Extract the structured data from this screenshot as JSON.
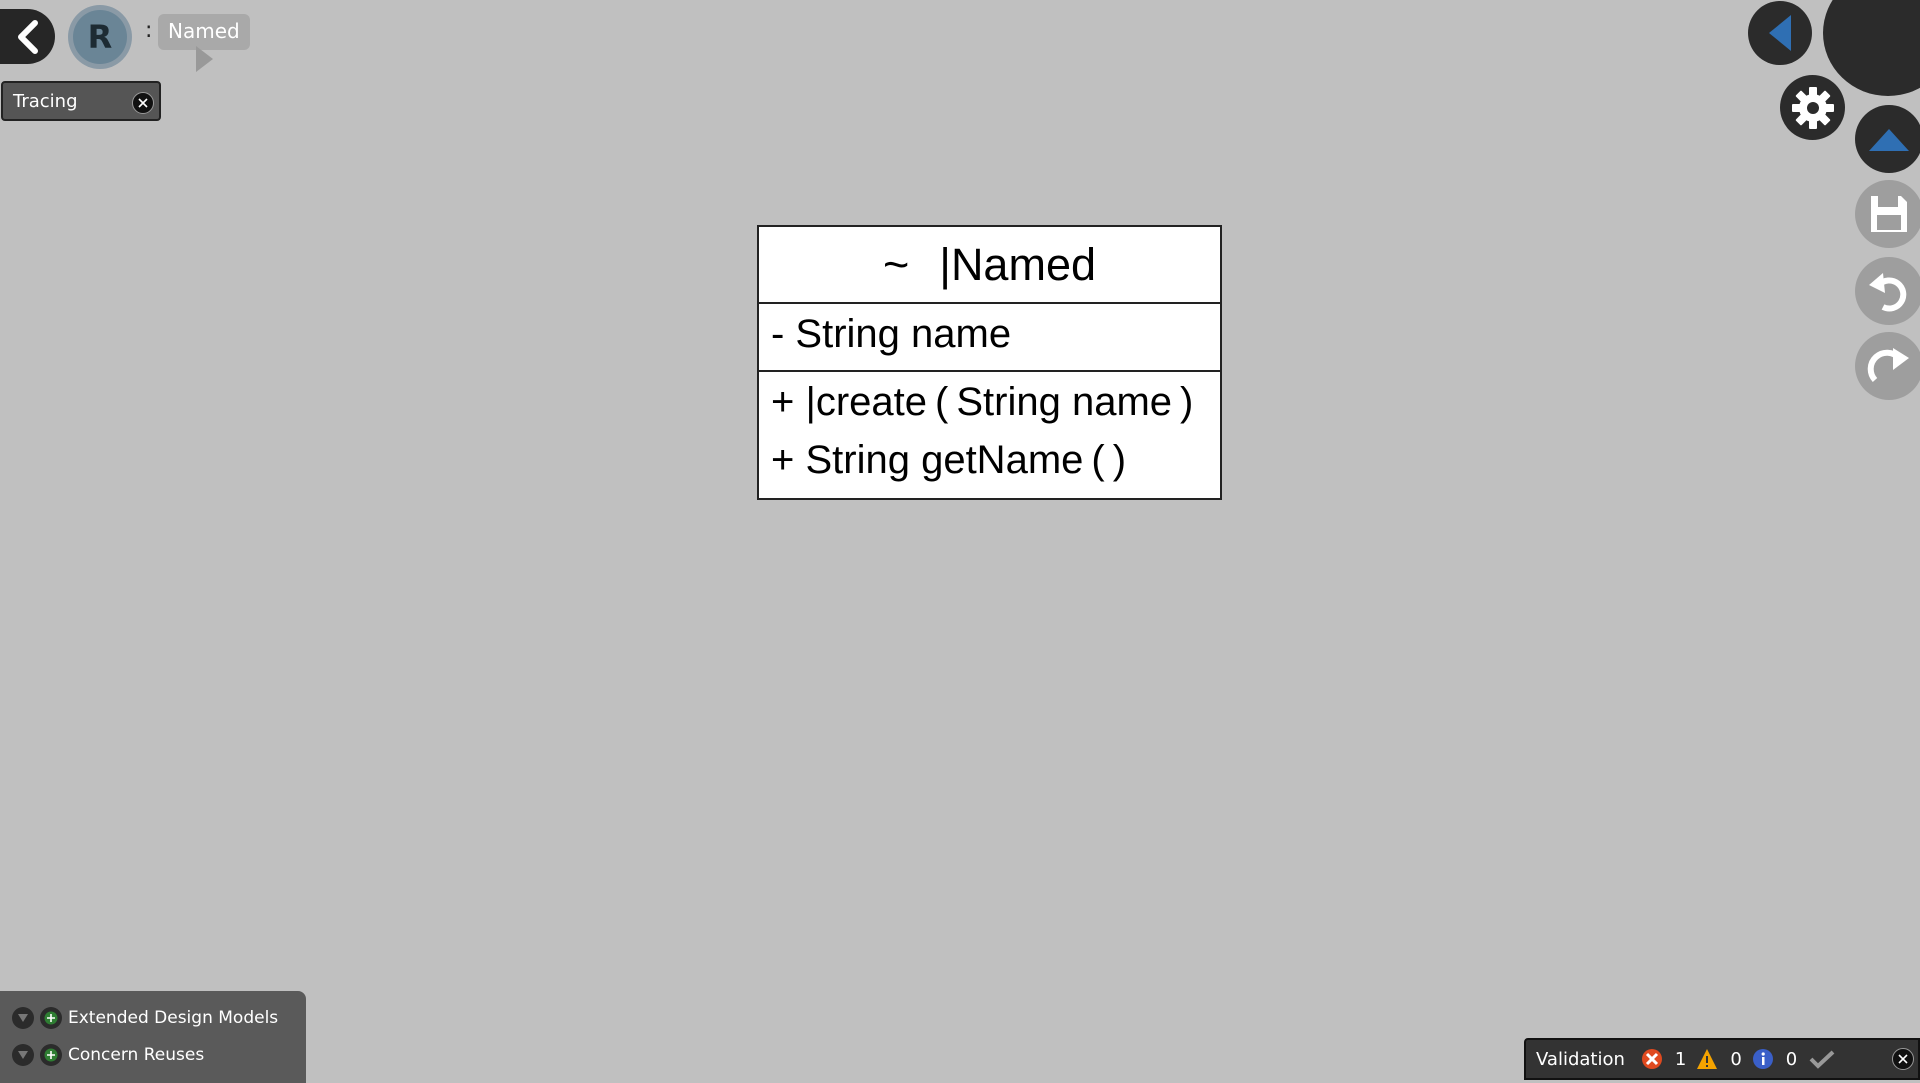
{
  "header": {
    "avatar_letter": "R",
    "separator": ":",
    "breadcrumb": "Named"
  },
  "tracing": {
    "label": "Tracing"
  },
  "class_box": {
    "visibility": "~",
    "name": "|Named",
    "attributes": [
      "- String name"
    ],
    "operations": [
      "+ |create ( String name )",
      "+ String getName ( )"
    ]
  },
  "bottom_panel": {
    "items": [
      {
        "label": "Extended Design Models"
      },
      {
        "label": "Concern Reuses"
      }
    ]
  },
  "validation": {
    "label": "Validation",
    "errors": "1",
    "warnings": "0",
    "infos": "0"
  },
  "icons": {
    "back": "chevron-left-icon",
    "nav_left": "triangle-left-icon",
    "settings": "gear-icon",
    "up": "triangle-up-icon",
    "save": "floppy-disk-icon",
    "undo": "undo-icon",
    "redo": "redo-icon"
  },
  "colors": {
    "background": "#c0c0c0",
    "accent_blue": "#2f6fb3",
    "error": "#e04a1f",
    "warning": "#f4a300",
    "info": "#3a5fc8"
  }
}
